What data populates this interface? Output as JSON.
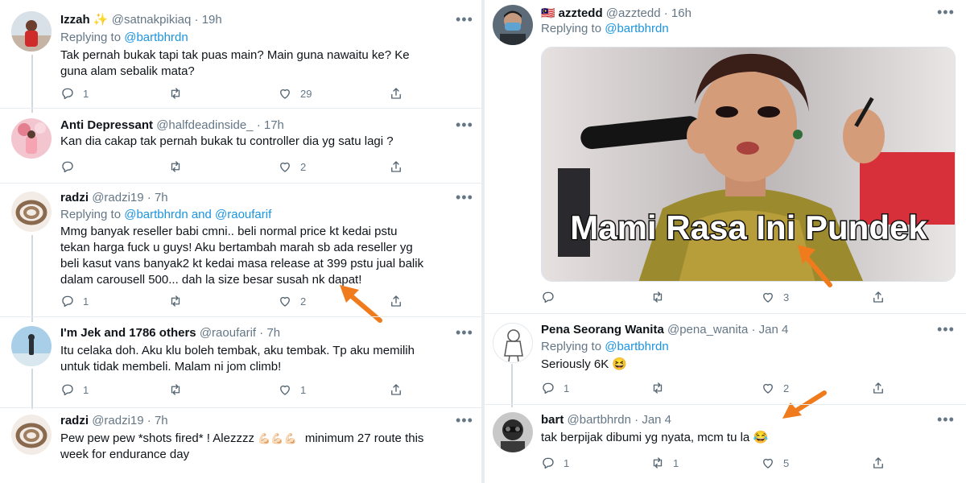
{
  "left": {
    "tweets": [
      {
        "name": "Izzah",
        "name_suffix": "✨",
        "handle": "@satnakpikiaq",
        "time": "19h",
        "reply_prefix": "Replying to",
        "reply_to": "@bartbhrdn",
        "lines": [
          "Tak pernah bukak tapi tak puas main? Main guna nawaitu ke? Ke",
          "guna alam sebalik mata?"
        ],
        "replies": "1",
        "retweets": "",
        "likes": "29"
      },
      {
        "name": "Anti Depressant",
        "handle": "@halfdeadinside_",
        "time": "17h",
        "lines": [
          "Kan dia cakap tak pernah bukak tu controller dia yg satu lagi ?"
        ],
        "replies": "",
        "retweets": "",
        "likes": "2"
      },
      {
        "name": "radzi",
        "handle": "@radzi19",
        "time": "7h",
        "reply_prefix": "Replying to",
        "reply_to": "@bartbhrdn and @raoufarif",
        "lines": [
          "Mmg banyak reseller babi cmni.. beli normal price kt kedai pstu",
          "tekan harga fuck u guys! Aku bertambah marah sb ada reseller yg",
          "beli kasut vans banyak2 kt kedai masa release at 399 pstu jual balik",
          "dalam carousell 500... dah la size  besar susah nk dapat!"
        ],
        "replies": "1",
        "retweets": "",
        "likes": "2"
      },
      {
        "name": "I'm Jek and 1786 others",
        "handle": "@raoufarif",
        "time": "7h",
        "lines": [
          "Itu celaka doh. Aku klu boleh tembak, aku tembak. Tp aku memilih",
          "untuk tidak membeli. Malam ni jom climb!"
        ],
        "replies": "1",
        "retweets": "",
        "likes": "1"
      },
      {
        "name": "radzi",
        "handle": "@radzi19",
        "time": "7h",
        "lines": [
          "Pew pew pew *shots fired* ! Alezzzz",
          "minimum 27 route this",
          "week for endurance day"
        ],
        "emoji": "💪🏻💪🏻💪🏻"
      }
    ]
  },
  "right": {
    "tweets": [
      {
        "flag": "🇲🇾",
        "name": "azztedd",
        "handle": "@azztedd",
        "time": "16h",
        "reply_prefix": "Replying to",
        "reply_to": "@bartbhrdn",
        "meme_caption": "Mami Rasa Ini Pundek",
        "replies": "",
        "retweets": "",
        "likes": "3"
      },
      {
        "name": "Pena Seorang Wanita",
        "handle": "@pena_wanita",
        "time": "Jan 4",
        "reply_prefix": "Replying to",
        "reply_to": "@bartbhrdn",
        "lines": [
          "Seriously 6K 😆"
        ],
        "replies": "1",
        "retweets": "",
        "likes": "2"
      },
      {
        "name": "bart",
        "handle": "@bartbhrdn",
        "time": "Jan 4",
        "lines": [
          "tak berpijak dibumi yg nyata, mcm tu la 😂"
        ],
        "replies": "1",
        "retweets": "1",
        "likes": "5"
      }
    ]
  },
  "colors": {
    "link": "#1b95e0",
    "muted": "#657786",
    "arrow": "#f07b1d",
    "separator": "#e6ecf0"
  }
}
